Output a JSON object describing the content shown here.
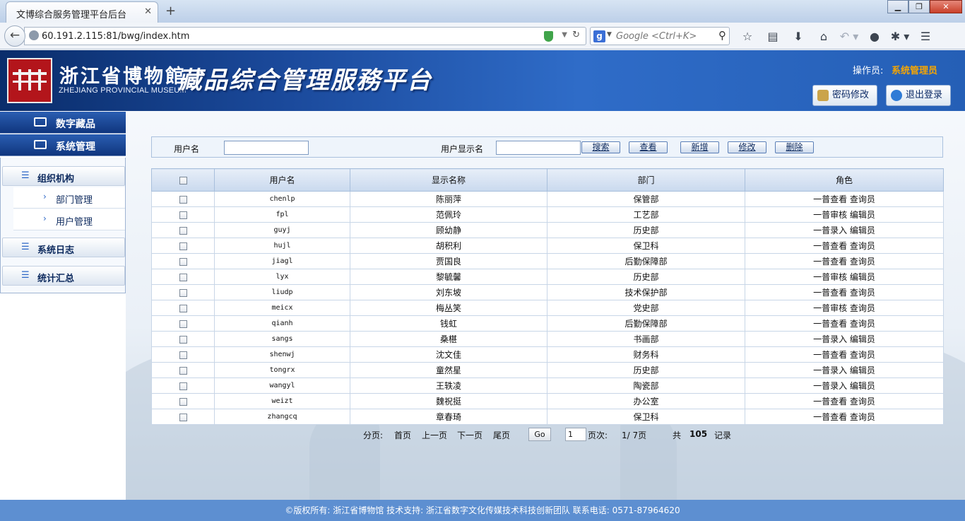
{
  "browser": {
    "tab_title": "文博综合服务管理平台后台",
    "url": "60.191.2.115:81/bwg/index.htm",
    "search_placeholder": "Google <Ctrl+K>",
    "engine_letter": "g"
  },
  "header": {
    "museum_cn": "浙江省博物館",
    "museum_en": "ZHEJIANG PROVINCIAL MUSEUM",
    "platform_title": "藏品综合管理服務平台",
    "operator_label": "操作员:",
    "operator_name": "系统管理员",
    "change_password": "密码修改",
    "logout": "退出登录"
  },
  "sidebar": {
    "top_items": [
      "数字藏品",
      "系统管理"
    ],
    "groups": [
      {
        "label": "组织机构",
        "children": [
          "部门管理",
          "用户管理"
        ]
      },
      {
        "label": "系统日志"
      },
      {
        "label": "统计汇总"
      }
    ]
  },
  "search": {
    "username_label": "用户名",
    "display_label": "用户显示名",
    "username_value": "",
    "display_value": "",
    "buttons": [
      "搜索",
      "查看",
      "新增",
      "修改",
      "删除"
    ]
  },
  "table": {
    "columns": [
      "",
      "用户名",
      "显示名称",
      "部门",
      "角色"
    ],
    "rows": [
      [
        "chenlp",
        "陈丽萍",
        "保管部",
        "一普查看 查询员"
      ],
      [
        "fpl",
        "范佩玲",
        "工艺部",
        "一普审核 编辑员"
      ],
      [
        "guyj",
        "顾幼静",
        "历史部",
        "一普录入 编辑员"
      ],
      [
        "hujl",
        "胡积利",
        "保卫科",
        "一普查看 查询员"
      ],
      [
        "jiagl",
        "贾国良",
        "后勤保障部",
        "一普查看 查询员"
      ],
      [
        "lyx",
        "黎毓馨",
        "历史部",
        "一普审核 编辑员"
      ],
      [
        "liudp",
        "刘东坡",
        "技术保护部",
        "一普查看 查询员"
      ],
      [
        "meicx",
        "梅丛笑",
        "党史部",
        "一普审核 查询员"
      ],
      [
        "qianh",
        "钱虹",
        "后勤保障部",
        "一普查看 查询员"
      ],
      [
        "sangs",
        "桑椹",
        "书画部",
        "一普录入 编辑员"
      ],
      [
        "shenwj",
        "沈文佳",
        "财务科",
        "一普查看 查询员"
      ],
      [
        "tongrx",
        "童然星",
        "历史部",
        "一普录入 编辑员"
      ],
      [
        "wangyl",
        "王轶凌",
        "陶瓷部",
        "一普录入 编辑员"
      ],
      [
        "weizt",
        "魏祝挺",
        "办公室",
        "一普查看 查询员"
      ],
      [
        "zhangcq",
        "章春琦",
        "保卫科",
        "一普查看 查询员"
      ]
    ]
  },
  "pager": {
    "label": "分页:",
    "first": "首页",
    "prev": "上一页",
    "next": "下一页",
    "last": "尾页",
    "go": "Go",
    "page_input": "1",
    "page_label": "页次:",
    "page_status": "1/ 7页",
    "total_prefix": "共",
    "total": "105",
    "total_suffix": "记录"
  },
  "footer": {
    "text": "©版权所有: 浙江省博物馆 技术支持: 浙江省数字文化传媒技术科技创新团队    联系电话: 0571-87964620"
  },
  "colors": {
    "header_blue": "#1b4a9c",
    "operator_accent": "#f7a600",
    "footer_blue": "#5d8fd1"
  }
}
